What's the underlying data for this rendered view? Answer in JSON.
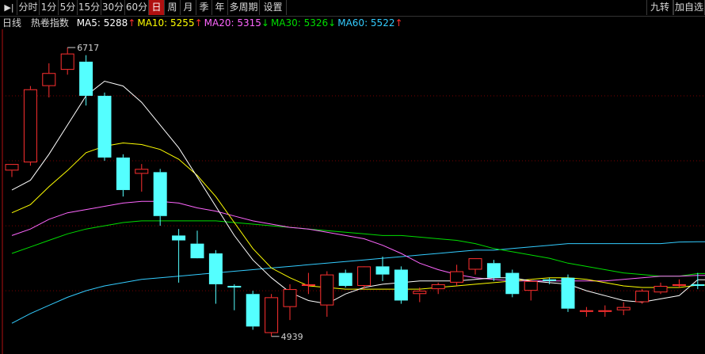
{
  "toolbar": {
    "left_icon": "collapse-left-icon",
    "periods": [
      "分时",
      "1分",
      "5分",
      "15分",
      "30分",
      "60分",
      "日",
      "周",
      "月",
      "季",
      "年",
      "多周期",
      "设置"
    ],
    "active_period": "日",
    "right_buttons": [
      "九转",
      "加自选"
    ]
  },
  "legend": {
    "period_label": "日线",
    "instrument": "热卷指数",
    "items": [
      {
        "label": "MA5: 5288",
        "arrow": "↑",
        "color": "#ffffff"
      },
      {
        "label": "MA10: 5255",
        "arrow": "↑",
        "color": "#ffff00"
      },
      {
        "label": "MA20: 5315",
        "arrow": "↓",
        "color": "#ff66ff"
      },
      {
        "label": "MA30: 5326",
        "arrow": "↓",
        "color": "#00dd00"
      },
      {
        "label": "MA60: 5522",
        "arrow": "↑",
        "color": "#33ccff"
      }
    ]
  },
  "colors": {
    "up": "#ff3030",
    "down": "#54ffff",
    "grid": "#7a0000",
    "ma5": "#ffffff",
    "ma10": "#ffff00",
    "ma20": "#ff66ff",
    "ma30": "#00dd00",
    "ma60": "#33ccff"
  },
  "chart_data": {
    "type": "candlestick",
    "ylim": [
      4860,
      6800
    ],
    "grid_levels": [
      6420,
      6020,
      5620,
      5220,
      4820
    ],
    "max_label": "6717",
    "min_label": "4939",
    "candles": [
      {
        "o": 5960,
        "h": 6000,
        "l": 5920,
        "c": 6000
      },
      {
        "o": 6010,
        "h": 6480,
        "l": 5990,
        "c": 6460
      },
      {
        "o": 6480,
        "h": 6620,
        "l": 6410,
        "c": 6560
      },
      {
        "o": 6580,
        "h": 6717,
        "l": 6550,
        "c": 6680
      },
      {
        "o": 6630,
        "h": 6670,
        "l": 6360,
        "c": 6420
      },
      {
        "o": 6420,
        "h": 6440,
        "l": 6020,
        "c": 6040
      },
      {
        "o": 6040,
        "h": 6060,
        "l": 5800,
        "c": 5840
      },
      {
        "o": 5940,
        "h": 6000,
        "l": 5830,
        "c": 5970
      },
      {
        "o": 5950,
        "h": 5970,
        "l": 5620,
        "c": 5680
      },
      {
        "o": 5560,
        "h": 5600,
        "l": 5270,
        "c": 5530
      },
      {
        "o": 5510,
        "h": 5590,
        "l": 5450,
        "c": 5420
      },
      {
        "o": 5450,
        "h": 5470,
        "l": 5140,
        "c": 5260
      },
      {
        "o": 5250,
        "h": 5260,
        "l": 5100,
        "c": 5240
      },
      {
        "o": 5200,
        "h": 5220,
        "l": 4980,
        "c": 5000
      },
      {
        "o": 4960,
        "h": 5200,
        "l": 4939,
        "c": 5180
      },
      {
        "o": 5120,
        "h": 5260,
        "l": 5040,
        "c": 5230
      },
      {
        "o": 5250,
        "h": 5330,
        "l": 5200,
        "c": 5260
      },
      {
        "o": 5130,
        "h": 5340,
        "l": 5060,
        "c": 5320
      },
      {
        "o": 5330,
        "h": 5350,
        "l": 5240,
        "c": 5250
      },
      {
        "o": 5250,
        "h": 5360,
        "l": 5230,
        "c": 5370
      },
      {
        "o": 5370,
        "h": 5430,
        "l": 5280,
        "c": 5320
      },
      {
        "o": 5350,
        "h": 5370,
        "l": 5140,
        "c": 5160
      },
      {
        "o": 5200,
        "h": 5240,
        "l": 5150,
        "c": 5220
      },
      {
        "o": 5230,
        "h": 5270,
        "l": 5200,
        "c": 5260
      },
      {
        "o": 5270,
        "h": 5380,
        "l": 5250,
        "c": 5340
      },
      {
        "o": 5350,
        "h": 5420,
        "l": 5320,
        "c": 5420
      },
      {
        "o": 5390,
        "h": 5410,
        "l": 5280,
        "c": 5300
      },
      {
        "o": 5330,
        "h": 5350,
        "l": 5180,
        "c": 5200
      },
      {
        "o": 5220,
        "h": 5290,
        "l": 5160,
        "c": 5280
      },
      {
        "o": 5290,
        "h": 5300,
        "l": 5260,
        "c": 5280
      },
      {
        "o": 5300,
        "h": 5320,
        "l": 5090,
        "c": 5110
      },
      {
        "o": 5090,
        "h": 5120,
        "l": 5060,
        "c": 5100
      },
      {
        "o": 5090,
        "h": 5130,
        "l": 5060,
        "c": 5100
      },
      {
        "o": 5100,
        "h": 5150,
        "l": 5070,
        "c": 5120
      },
      {
        "o": 5150,
        "h": 5230,
        "l": 5140,
        "c": 5220
      },
      {
        "o": 5210,
        "h": 5270,
        "l": 5200,
        "c": 5250
      },
      {
        "o": 5260,
        "h": 5290,
        "l": 5240,
        "c": 5260
      },
      {
        "o": 5260,
        "h": 5330,
        "l": 5230,
        "c": 5250
      }
    ],
    "ma": {
      "ma5": [
        5840,
        5900,
        6060,
        6240,
        6420,
        6510,
        6480,
        6380,
        6240,
        6100,
        5920,
        5740,
        5560,
        5410,
        5300,
        5210,
        5160,
        5140,
        5200,
        5240,
        5260,
        5270,
        5280,
        5280,
        5280,
        5290,
        5300,
        5300,
        5280,
        5270,
        5260,
        5220,
        5190,
        5160,
        5150,
        5170,
        5190,
        5288
      ],
      "ma10": [
        5700,
        5750,
        5860,
        5960,
        6070,
        6110,
        6130,
        6120,
        6090,
        6030,
        5930,
        5800,
        5640,
        5480,
        5360,
        5300,
        5250,
        5240,
        5230,
        5230,
        5230,
        5230,
        5230,
        5240,
        5250,
        5260,
        5270,
        5280,
        5290,
        5300,
        5300,
        5290,
        5270,
        5250,
        5240,
        5240,
        5240,
        5255
      ],
      "ma20": [
        5560,
        5600,
        5660,
        5700,
        5720,
        5740,
        5760,
        5770,
        5770,
        5760,
        5730,
        5710,
        5680,
        5650,
        5630,
        5610,
        5600,
        5580,
        5560,
        5540,
        5500,
        5450,
        5390,
        5350,
        5320,
        5300,
        5290,
        5280,
        5280,
        5280,
        5280,
        5280,
        5280,
        5290,
        5300,
        5310,
        5310,
        5315
      ],
      "ma30": [
        5450,
        5490,
        5530,
        5570,
        5600,
        5620,
        5640,
        5650,
        5650,
        5650,
        5650,
        5650,
        5640,
        5630,
        5620,
        5610,
        5600,
        5590,
        5580,
        5570,
        5560,
        5560,
        5550,
        5540,
        5530,
        5510,
        5480,
        5460,
        5440,
        5420,
        5390,
        5370,
        5350,
        5330,
        5320,
        5310,
        5310,
        5326
      ],
      "ma60": [
        5020,
        5080,
        5130,
        5180,
        5220,
        5250,
        5270,
        5290,
        5300,
        5310,
        5320,
        5330,
        5340,
        5350,
        5360,
        5370,
        5380,
        5390,
        5400,
        5410,
        5420,
        5430,
        5440,
        5450,
        5460,
        5470,
        5470,
        5480,
        5490,
        5500,
        5510,
        5510,
        5510,
        5510,
        5510,
        5510,
        5520,
        5522
      ]
    }
  }
}
